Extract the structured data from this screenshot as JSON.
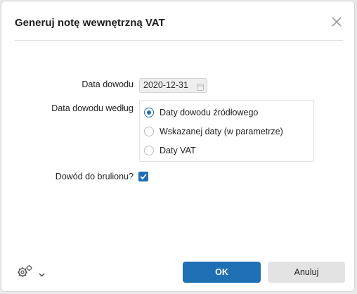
{
  "dialog": {
    "title": "Generuj notę wewnętrzną VAT",
    "close_icon": "close-icon"
  },
  "form": {
    "date_label": "Data dowodu",
    "date_value": "2020-12-31",
    "date_basis_label": "Data dowodu według",
    "date_basis_options": [
      {
        "label": "Daty dowodu źródłowego",
        "checked": true
      },
      {
        "label": "Wskazanej daty (w parametrze)",
        "checked": false
      },
      {
        "label": "Daty VAT",
        "checked": false
      }
    ],
    "draft_label": "Dowód do brulionu?",
    "draft_checked": true
  },
  "footer": {
    "settings_icon": "gears-icon",
    "ok_label": "OK",
    "cancel_label": "Anuluj"
  },
  "colors": {
    "accent": "#1f6fb5",
    "cancel_bg": "#e3e3e3"
  }
}
